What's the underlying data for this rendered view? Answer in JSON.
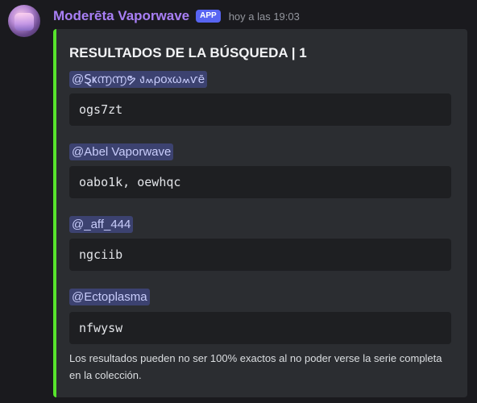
{
  "message": {
    "username": "Moderēta Vaporwave",
    "badge": "APP",
    "timestamp": "hoy a las 19:03",
    "avatar_icon": "avatar-image",
    "username_color": "#a87ff5",
    "accent_color": "#57e32c"
  },
  "embed": {
    "title": "RESULTADOS DE LA BÚSQUEDA | 1",
    "entries": [
      {
        "mention": "@Ȿҝ൬൬ຯ ง៳ρo᥊ω៳ѵē",
        "code": "ogs7zt"
      },
      {
        "mention": "@Abel Vaporwave",
        "code": "oabo1k, oewhqc"
      },
      {
        "mention": "@_aff_444",
        "code": "ngciib"
      },
      {
        "mention": "@Ectoplasma",
        "code": "nfwysw"
      }
    ],
    "footer": "Los resultados pueden no ser 100% exactos al no poder verse la serie completa en la colección."
  }
}
